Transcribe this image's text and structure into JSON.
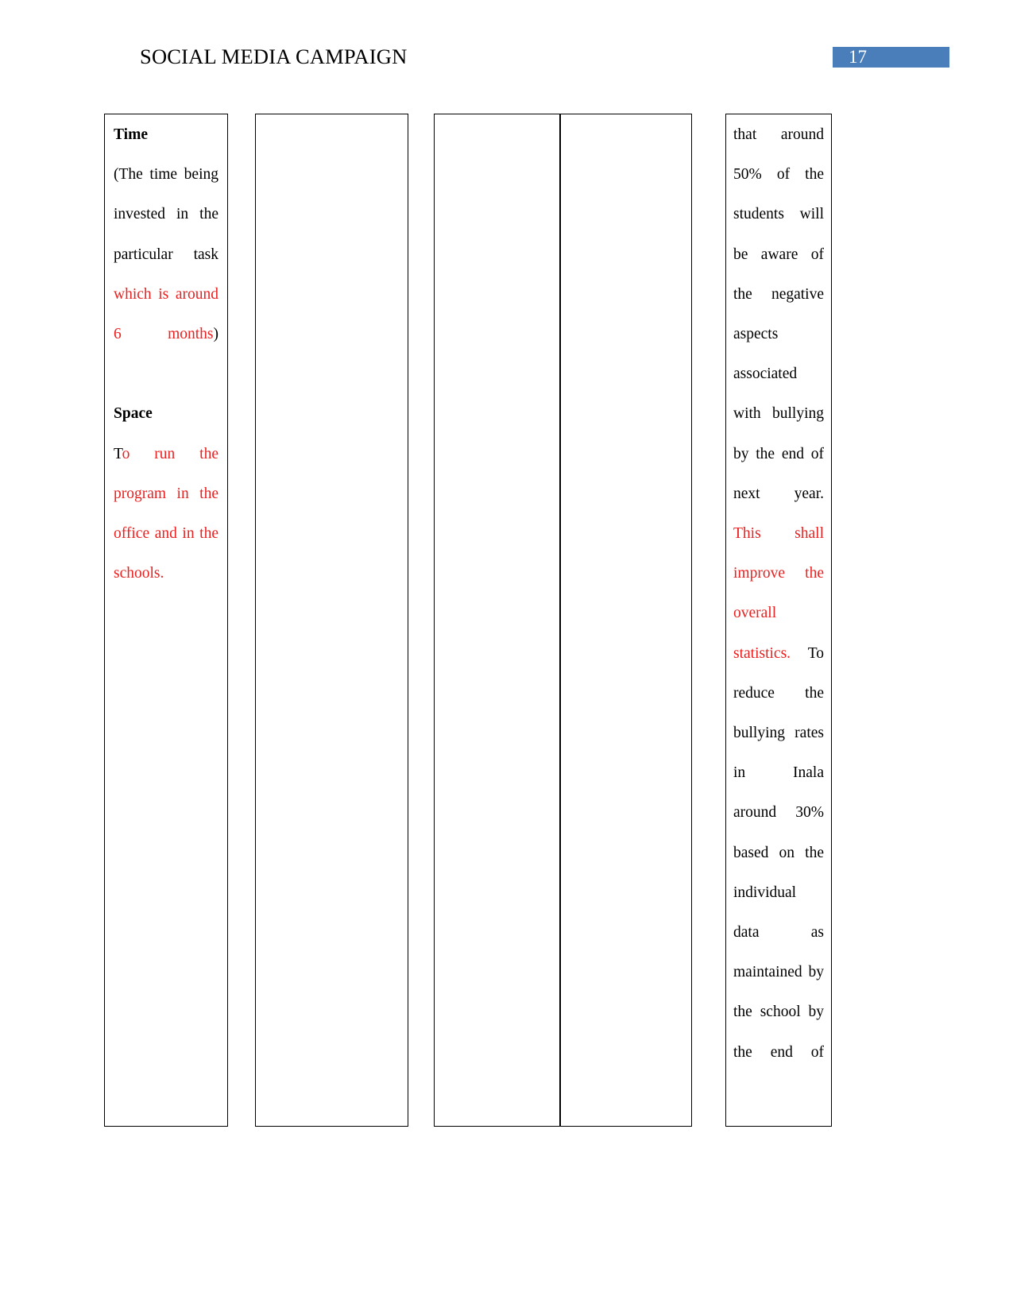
{
  "document": {
    "header": {
      "title": "SOCIAL MEDIA CAMPAIGN",
      "page_number": "17",
      "badge_color": "#4a7ebb"
    },
    "colors": {
      "revision_red": "#e92121",
      "body_black": "#000000",
      "table_border": "#000000"
    },
    "table": {
      "columns": [
        {
          "name": "resources-column",
          "sections": [
            {
              "heading": "Time",
              "segments": [
                {
                  "text": "(The time being invested in the particular task ",
                  "color": "black"
                },
                {
                  "text": "which is around 6 months",
                  "color": "red"
                },
                {
                  "text": ")",
                  "color": "black"
                }
              ]
            },
            {
              "heading": "Space",
              "segments": [
                {
                  "text": "T",
                  "color": "black"
                },
                {
                  "text": "o run the program in the office and in the schools.",
                  "color": "red"
                }
              ]
            }
          ]
        },
        {
          "name": "blank-column-a",
          "sections": []
        },
        {
          "name": "blank-column-b",
          "sections": []
        },
        {
          "name": "blank-column-c",
          "sections": []
        },
        {
          "name": "outcomes-column",
          "sections": [
            {
              "heading": "",
              "segments": [
                {
                  "text": "that around 50% of the students will be aware of the negative aspects associated with bullying by the end of next year. ",
                  "color": "black"
                },
                {
                  "text": "This shall improve the overall statistics.",
                  "color": "red"
                },
                {
                  "text": " To reduce the bullying rates in Inala around 30% based on the individual data as maintained by the school by the end of",
                  "color": "black"
                }
              ]
            }
          ]
        }
      ]
    }
  }
}
